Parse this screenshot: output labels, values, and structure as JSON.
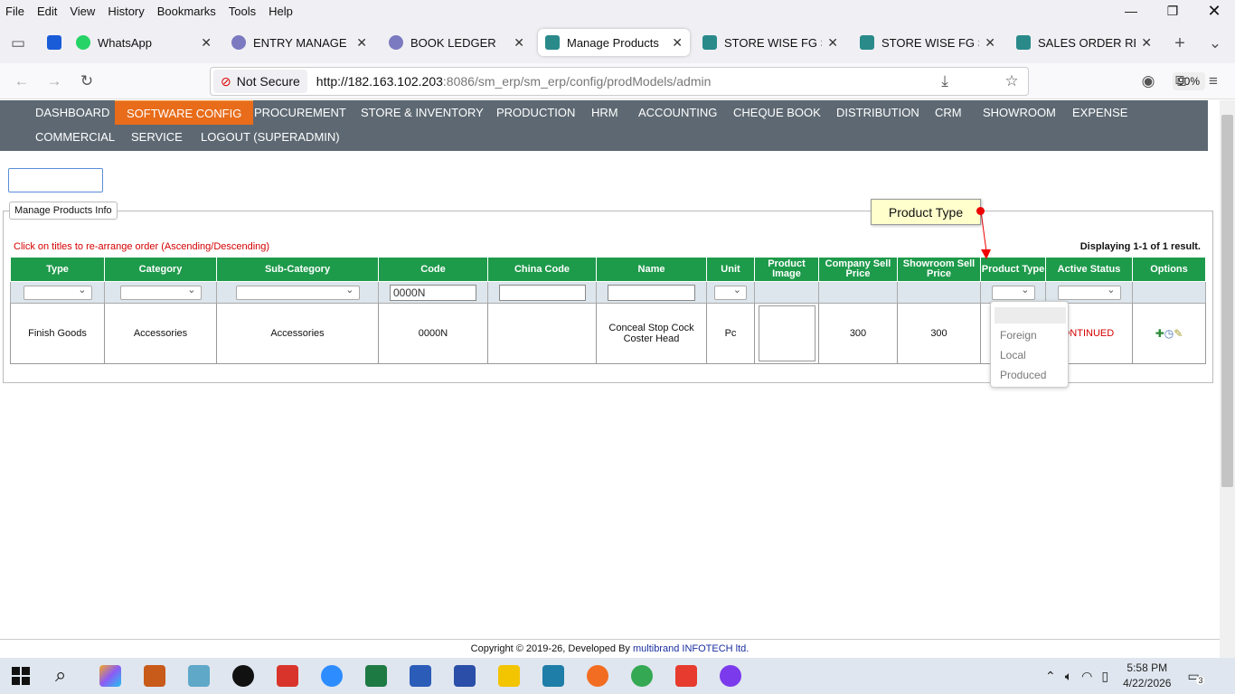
{
  "menubar": {
    "items": [
      "File",
      "Edit",
      "View",
      "History",
      "Bookmarks",
      "Tools",
      "Help"
    ]
  },
  "tabs": [
    {
      "label": "WhatsApp",
      "icon": "whatsapp-icon",
      "color": "#25d366"
    },
    {
      "label": "ENTRY MANAGE",
      "icon": "gear-icon",
      "color": "#7b79c0"
    },
    {
      "label": "BOOK LEDGER",
      "icon": "gear-icon",
      "color": "#7b79c0"
    },
    {
      "label": "Manage Products",
      "icon": "app-logo-icon",
      "color": "#2a8a8a"
    },
    {
      "label": "STORE WISE FG STOCK",
      "icon": "app-logo-icon",
      "color": "#2a8a8a"
    },
    {
      "label": "STORE WISE FG STOCK",
      "icon": "app-logo-icon",
      "color": "#2a8a8a"
    },
    {
      "label": "SALES ORDER REPORT",
      "icon": "app-logo-icon",
      "color": "#2a8a8a"
    }
  ],
  "addressbar": {
    "security": "Not Secure",
    "url_host": "http://182.163.102.203",
    "url_path": ":8086/sm_erp/sm_erp/config/prodModels/admin",
    "zoom": "90%"
  },
  "appnav": {
    "items": [
      "DASHBOARD",
      "SOFTWARE CONFIG",
      "PROCUREMENT",
      "STORE & INVENTORY",
      "PRODUCTION",
      "HRM",
      "ACCOUNTING",
      "CHEQUE BOOK",
      "DISTRIBUTION",
      "CRM",
      "SHOWROOM",
      "EXPENSE",
      "COMMERCIAL",
      "SERVICE",
      "LOGOUT (SUPERADMIN)"
    ],
    "active": "SOFTWARE CONFIG",
    "active_color": "#e86c1a"
  },
  "panel": {
    "legend": "Manage Products Info",
    "hint": "Click on titles to re-arrange order (Ascending/Descending)",
    "displaying": "Displaying 1-1 of 1 result."
  },
  "table": {
    "headers": [
      "Type",
      "Category",
      "Sub-Category",
      "Code",
      "China Code",
      "Name",
      "Unit",
      "Product Image",
      "Company Sell Price",
      "Showroom Sell Price",
      "Product Type",
      "Active Status",
      "Options"
    ],
    "filter": {
      "code": "0000N",
      "china_code": "",
      "name": ""
    },
    "row": {
      "type": "Finish Goods",
      "category": "Accessories",
      "sub_category": "Accessories",
      "code": "0000N",
      "china_code": "",
      "name": "Conceal Stop Cock Coster Head",
      "unit": "Pc",
      "company_price": "300",
      "showroom_price": "300",
      "status": "CONTINUED"
    },
    "header_color": "#1e9a4b"
  },
  "tooltip": {
    "text": "Product Type"
  },
  "dropdown": {
    "options": [
      "Foreign",
      "Local",
      "Produced"
    ]
  },
  "footer": {
    "prefix": "Copyright © 2019-26, Developed By ",
    "link": "multibrand INFOTECH ltd."
  },
  "taskbar": {
    "time": "5:58 PM",
    "date": "4/22/2026",
    "notifications": "3"
  }
}
